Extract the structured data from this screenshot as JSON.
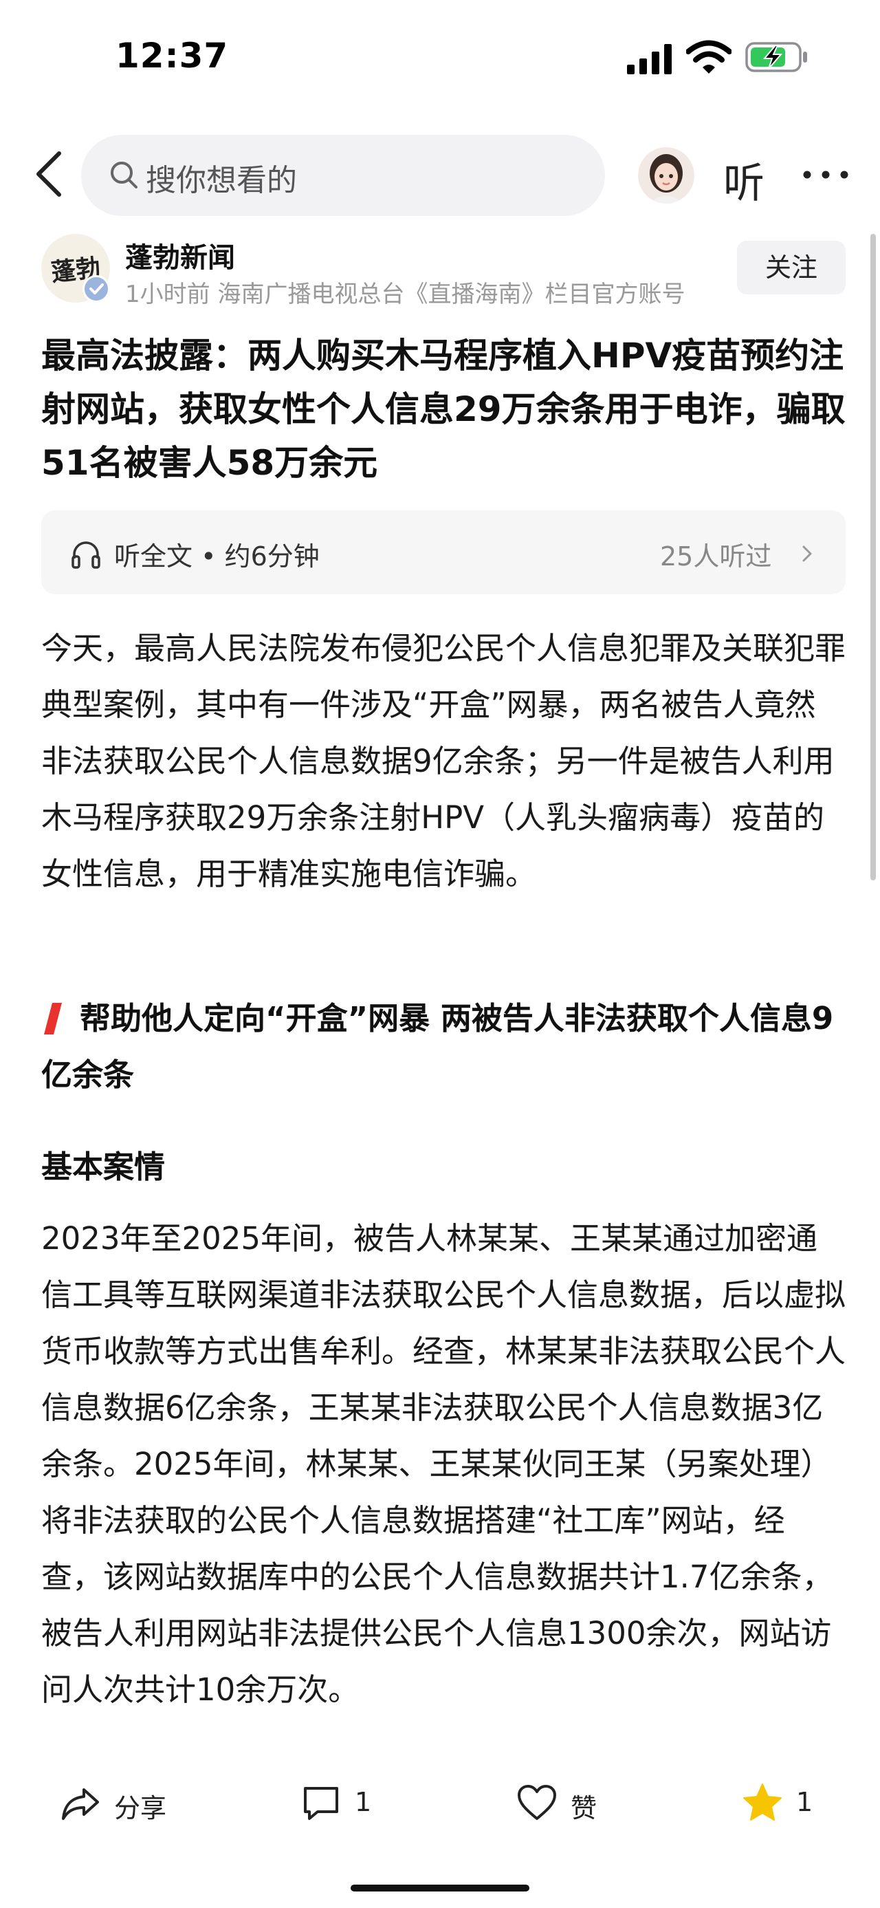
{
  "status_bar": {
    "time": "12:37",
    "battery_color": "#34c759"
  },
  "nav": {
    "search_placeholder": "搜你想看的",
    "listen_label": "听"
  },
  "author": {
    "logo_text": "蓬勃",
    "name": "蓬勃新闻",
    "meta": "1小时前  海南广播电视总台《直播海南》栏目官方账号",
    "follow_label": "关注"
  },
  "article": {
    "title": "最高法披露：两人购买木马程序植入HPV疫苗预约注射网站，获取女性个人信息29万余条用于电诈，骗取51名被害人58万余元",
    "listen_bar": {
      "label": "听全文 • 约6分钟",
      "count": "25人听过"
    },
    "intro": "今天，最高人民法院发布侵犯公民个人信息犯罪及关联犯罪典型案例，其中有一件涉及“开盒”网暴，两名被告人竟然非法获取公民个人信息数据9亿余条；另一件是被告人利用木马程序获取29万余条注射HPV（人乳头瘤病毒）疫苗的女性信息，用于精准实施电信诈骗。",
    "section_title": "帮助他人定向“开盒”网暴  两被告人非法获取个人信息9亿余条",
    "subsection_title": "基本案情",
    "case_text": "2023年至2025年间，被告人林某某、王某某通过加密通信工具等互联网渠道非法获取公民个人信息数据，后以虚拟货币收款等方式出售牟利。经查，林某某非法获取公民个人信息数据6亿余条，王某某非法获取公民个人信息数据3亿余条。2025年间，林某某、王某某伙同王某（另案处理）将非法获取的公民个人信息数据搭建“社工库”网站，经查，该网站数据库中的公民个人信息数据共计1.7亿余条，被告人利用网站非法提供公民个人信息1300余次，网站访问人次共计10余万次。",
    "accent_color": "#e8322d"
  },
  "actions": {
    "share_label": "分享",
    "comment_count": "1",
    "like_label": "赞",
    "favorite_count": "1",
    "favorite_color": "#f7c400"
  },
  "icons": [
    "back-icon",
    "search-icon",
    "avatar",
    "more-icon",
    "verified-icon",
    "headphone-icon",
    "chevron-right-icon",
    "share-icon",
    "comment-icon",
    "like-icon",
    "star-icon"
  ]
}
